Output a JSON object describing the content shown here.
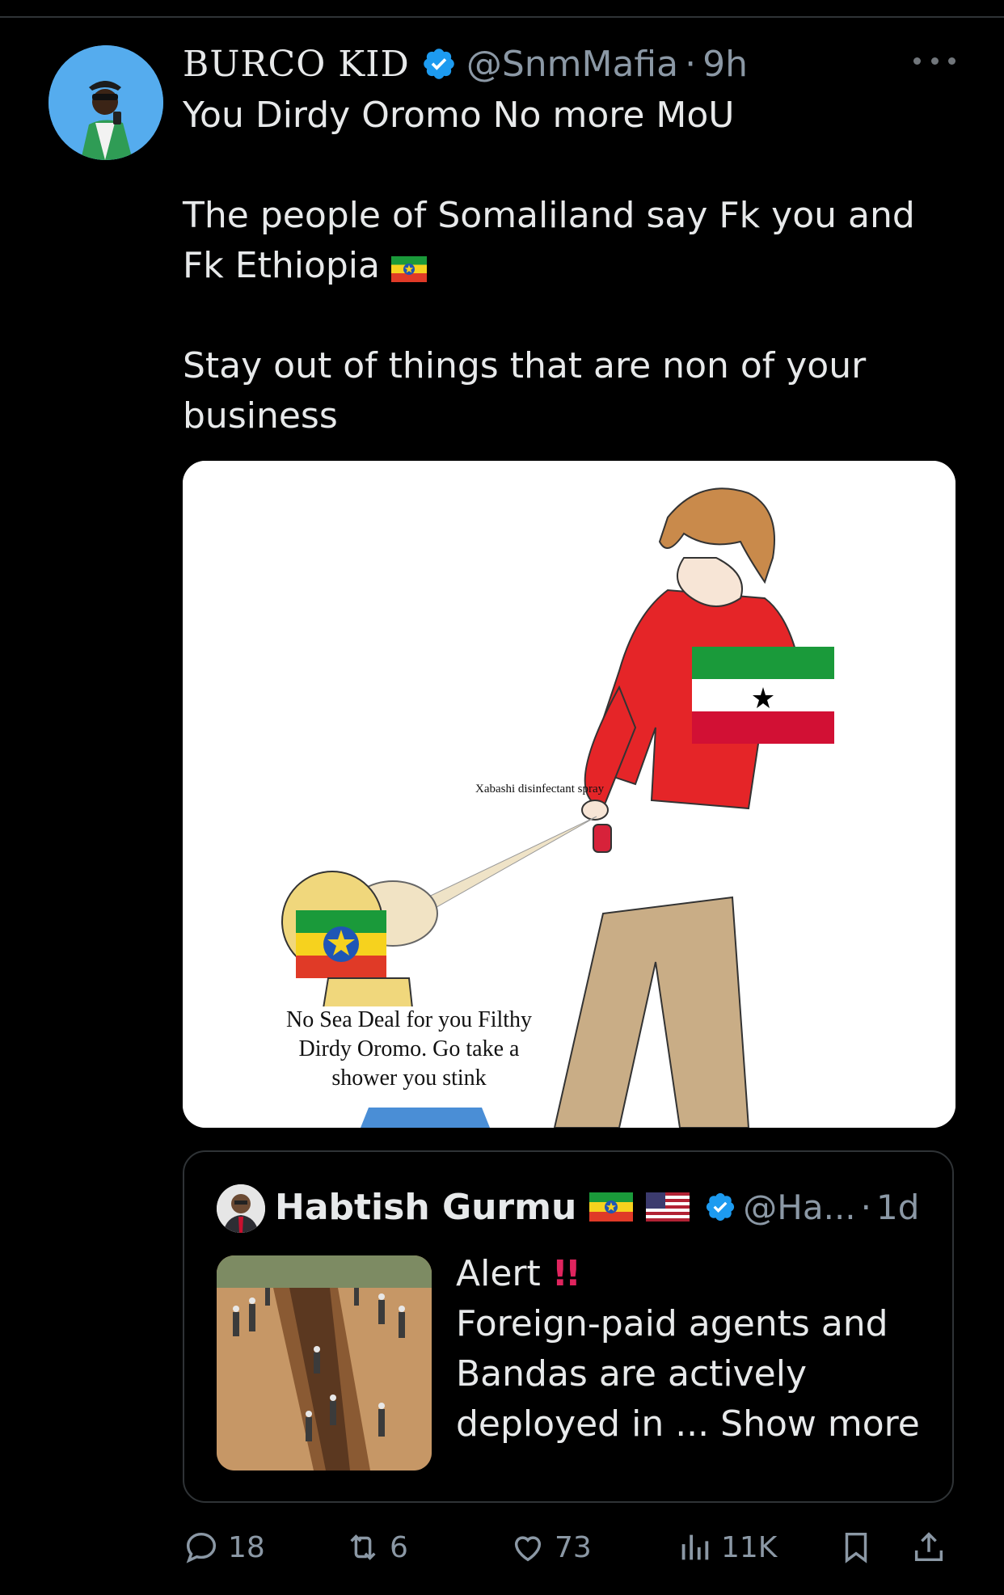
{
  "tweet": {
    "display_name": "BURCO KID",
    "handle": "@SnmMafia",
    "separator": "·",
    "time": "9h",
    "paragraphs": [
      "You Dirdy Oromo No more MoU",
      "The people of Somaliland say Fk you and Fk Ethiopia",
      "Stay out of things that are non of your business"
    ],
    "inline_flag": "ethiopia-flag-icon",
    "media": {
      "spray_label": "Xabashi disinfectant spray",
      "caption_lines": [
        "No Sea Deal for you Filthy",
        "Dirdy Oromo. Go take a",
        "shower you stink"
      ]
    }
  },
  "quoted_tweet": {
    "display_name": "Habtish Gurmu",
    "flags": [
      "ethiopia-flag-icon",
      "usa-flag-icon"
    ],
    "handle": "@Ha...",
    "separator": "·",
    "time": "1d",
    "line1": "Alert",
    "alert_emoji": "!!",
    "body_lines": [
      "Foreign-paid agents and",
      "Bandas are actively",
      "deployed in ... Show more"
    ]
  },
  "actions": {
    "replies": "18",
    "reposts": "6",
    "likes": "73",
    "views": "11K"
  },
  "colors": {
    "background": "#000000",
    "text": "#e7e9ea",
    "muted": "#8b98a5",
    "verified": "#1d9bf0",
    "border": "#2f3336"
  }
}
